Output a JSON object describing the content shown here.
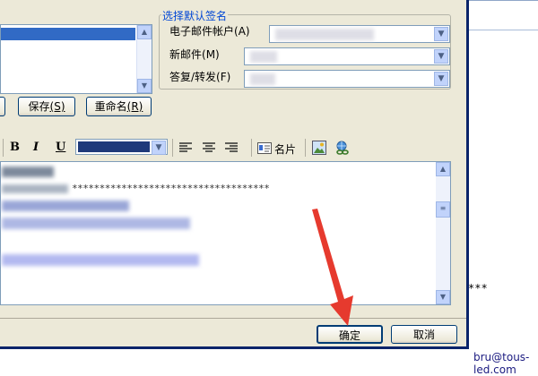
{
  "background": {
    "stars_text": "***",
    "email_text": "bru@tous-led.com"
  },
  "signature_group": {
    "title": "选择默认签名",
    "email_account_label": "电子邮件帐户",
    "email_account_key": "(A)",
    "new_mail_label": "新邮件",
    "new_mail_key": "(M)",
    "reply_forward_label": "答复/转发",
    "reply_forward_key": "(F)"
  },
  "buttons": {
    "save_label": "保存",
    "save_key": "(S)",
    "rename_label": "重命名",
    "rename_key": "(R)",
    "ok_label": "确定",
    "cancel_label": "取消"
  },
  "toolbar": {
    "bold_label": "B",
    "italic_label": "I",
    "underline_label": "U",
    "font_color": "#1f3a7a",
    "business_card_label": "名片",
    "icons": [
      "align-left-icon",
      "align-center-icon",
      "align-right-icon",
      "business-card-icon",
      "picture-icon",
      "hyperlink-icon"
    ]
  },
  "editor": {
    "stars_line": "************************************"
  },
  "colors": {
    "dialog_bg": "#ece9d8",
    "group_title": "#0046d5",
    "arrow": "#e63a2e",
    "selection": "#316ac5"
  }
}
